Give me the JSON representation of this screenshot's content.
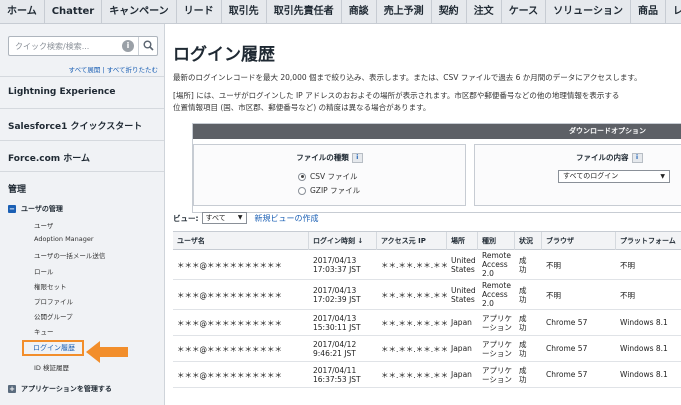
{
  "topnav": {
    "tabs": [
      "ホーム",
      "Chatter",
      "キャンペーン",
      "リード",
      "取引先",
      "取引先責任者",
      "商談",
      "売上予測",
      "契約",
      "注文",
      "ケース",
      "ソリューション",
      "商品",
      "レポー"
    ]
  },
  "sidebar": {
    "search_placeholder": "クイック検索/検索...",
    "expand_all": "すべて展開",
    "separator": "|",
    "collapse_all": "すべて折りたたむ",
    "sections": [
      "Lightning Experience",
      "Salesforce1 クイックスタート",
      "Force.com ホーム"
    ],
    "admin_title": "管理",
    "user_admin": {
      "label": "ユーザの管理",
      "items": [
        "ユーザ",
        "Adoption Manager",
        "ユーザの一括メール送信",
        "ロール",
        "権限セット",
        "プロファイル",
        "公開グループ",
        "キュー",
        "ログイン履歴",
        "ID 検証履歴"
      ],
      "active_item": "ログイン履歴"
    },
    "app_manage": "アプリケーションを管理する"
  },
  "main": {
    "title": "ログイン履歴",
    "desc_line1": "最新のログインレコードを最大 20,000 個まで絞り込み、表示します。または、CSV ファイルで過去 6 か月間のデータにアクセスします。",
    "desc_line2": "[場所] には、ユーザがログインした IP アドレスのおおよその場所が表示されます。市区郡や郵便番号などの他の地理情報を表示する",
    "desc_line3": "位置情報項目 (国、市区郡、郵便番号など) の精度は異なる場合があります。",
    "download": {
      "header": "ダウンロードオプション",
      "file_type_title": "ファイルの種類",
      "file_type_options": [
        "CSV ファイル",
        "GZIP ファイル"
      ],
      "file_content_title": "ファイルの内容",
      "file_content_selected": "すべてのログイン",
      "info_badge": "i"
    },
    "view": {
      "label": "ビュー:",
      "selected": "すべて",
      "new_view": "新規ビューの作成"
    },
    "table": {
      "headers": [
        "ユーザ名",
        "ログイン時刻 ↓",
        "アクセス元 IP",
        "場所",
        "種別",
        "状況",
        "ブラウザ",
        "プラットフォーム"
      ],
      "rows": [
        {
          "user": "＊＊＊@＊＊＊＊＊＊＊＊＊＊",
          "time1": "2017/04/13",
          "time2": "17:03:37 JST",
          "ip": "＊＊.＊＊.＊＊.＊＊",
          "loc1": "United",
          "loc2": "States",
          "type1": "Remote",
          "type2": "Access",
          "type3": "2.0",
          "status1": "成",
          "status2": "功",
          "browser": "不明",
          "platform": "不明"
        },
        {
          "user": "＊＊＊@＊＊＊＊＊＊＊＊＊＊",
          "time1": "2017/04/13",
          "time2": "17:02:39 JST",
          "ip": "＊＊.＊＊.＊＊.＊＊",
          "loc1": "United",
          "loc2": "States",
          "type1": "Remote",
          "type2": "Access",
          "type3": "2.0",
          "status1": "成",
          "status2": "功",
          "browser": "不明",
          "platform": "不明"
        },
        {
          "user": "＊＊＊@＊＊＊＊＊＊＊＊＊＊",
          "time1": "2017/04/13",
          "time2": "15:30:11 JST",
          "ip": "＊＊.＊＊.＊＊.＊＊",
          "loc1": "Japan",
          "loc2": "",
          "type1": "アプリケ",
          "type2": "ーション",
          "type3": "",
          "status1": "成",
          "status2": "功",
          "browser": "Chrome 57",
          "platform": "Windows 8.1"
        },
        {
          "user": "＊＊＊@＊＊＊＊＊＊＊＊＊＊",
          "time1": "2017/04/12",
          "time2": "9:46:21 JST",
          "ip": "＊＊.＊＊.＊＊.＊＊",
          "loc1": "Japan",
          "loc2": "",
          "type1": "アプリケ",
          "type2": "ーション",
          "type3": "",
          "status1": "成",
          "status2": "功",
          "browser": "Chrome 57",
          "platform": "Windows 8.1"
        },
        {
          "user": "＊＊＊@＊＊＊＊＊＊＊＊＊＊",
          "time1": "2017/04/11",
          "time2": "16:37:53 JST",
          "ip": "＊＊.＊＊.＊＊.＊＊",
          "loc1": "Japan",
          "loc2": "",
          "type1": "アプリケ",
          "type2": "ーション",
          "type3": "",
          "status1": "成",
          "status2": "功",
          "browser": "Chrome 57",
          "platform": "Windows 8.1"
        }
      ]
    }
  },
  "colors": {
    "accent_orange": "#f28e2b",
    "link_blue": "#1a5fb4",
    "header_dark": "#5d6066"
  },
  "icons": {
    "search": "search-icon",
    "info": "info-icon",
    "arrow": "pointer-arrow-icon"
  }
}
